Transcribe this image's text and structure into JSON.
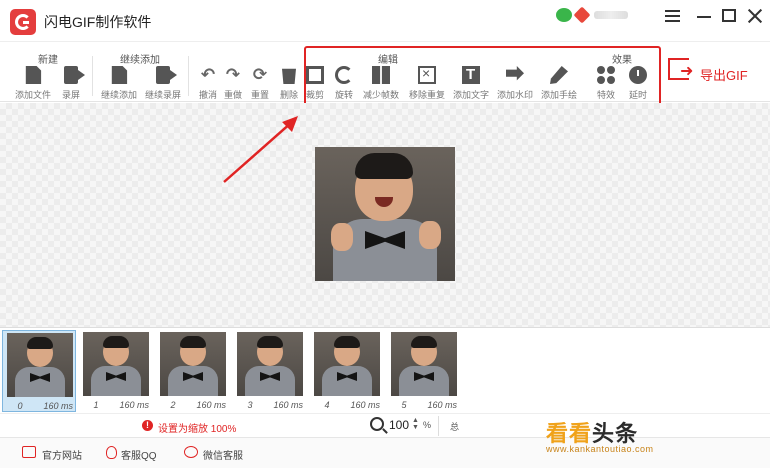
{
  "app": {
    "title": "闪电GIF制作软件"
  },
  "toolbar": {
    "groups": {
      "new": "新建",
      "continue": "继续添加",
      "edit": "编辑",
      "effects": "效果"
    },
    "buttons": {
      "add_file": "添加文件",
      "record": "录屏",
      "continue_add": "继续添加",
      "continue_record": "继续录屏",
      "undo": "撤消",
      "redo": "重做",
      "reset": "重置",
      "delete": "删除",
      "crop": "裁剪",
      "rotate": "旋转",
      "reduce_frames": "减少帧数",
      "remove_duplicates": "移除重复",
      "add_text": "添加文字",
      "add_watermark": "添加水印",
      "add_drawing": "添加手绘",
      "effects": "特效",
      "delay": "延时"
    },
    "export_label": "导出GIF"
  },
  "frames": [
    {
      "index": "0",
      "duration": "160 ms"
    },
    {
      "index": "1",
      "duration": "160 ms"
    },
    {
      "index": "2",
      "duration": "160 ms"
    },
    {
      "index": "3",
      "duration": "160 ms"
    },
    {
      "index": "4",
      "duration": "160 ms"
    },
    {
      "index": "5",
      "duration": "160 ms"
    }
  ],
  "status": {
    "message": "设置为缩放 100%",
    "zoom_value": "100",
    "zoom_unit": "%",
    "more": "总"
  },
  "footer": {
    "website": "官方网站",
    "qq_support": "客服QQ",
    "wechat_support": "微信客服"
  },
  "watermark": {
    "main_a": "看看",
    "main_b": "头条",
    "sub": "www.kankantoutiao.com"
  },
  "colors": {
    "accent_red": "#e02424",
    "watermark_orange": "#f0a21a"
  }
}
